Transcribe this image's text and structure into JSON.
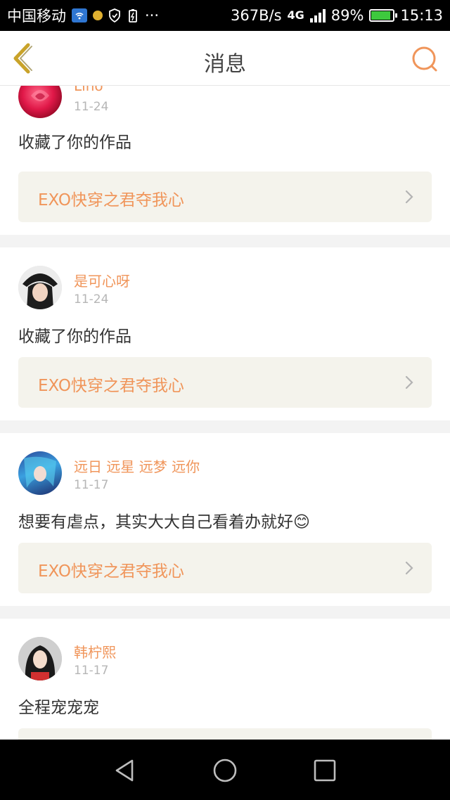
{
  "status_bar": {
    "carrier": "中国移动",
    "speed": "367B/s",
    "network": "4G",
    "battery": "89%",
    "battery_level": 0.89,
    "time": "15:13"
  },
  "header": {
    "title": "消息"
  },
  "messages": [
    {
      "user": "Lino",
      "date": "11-24",
      "text": "收藏了你的作品",
      "work": "EXO快穿之君夺我心"
    },
    {
      "user": "是可心呀",
      "date": "11-24",
      "text": "收藏了你的作品",
      "work": "EXO快穿之君夺我心"
    },
    {
      "user": "远日 远星 远梦 远你",
      "date": "11-17",
      "text": "想要有虐点，其实大大自己看着办就好",
      "emoji": "😊",
      "work": "EXO快穿之君夺我心"
    },
    {
      "user": "韩柠熙",
      "date": "11-17",
      "text": "全程宠宠宠"
    }
  ],
  "colors": {
    "accent": "#f0955a",
    "card_link_bg": "#f4f3ec",
    "back_arrow": "#c9a32a"
  }
}
